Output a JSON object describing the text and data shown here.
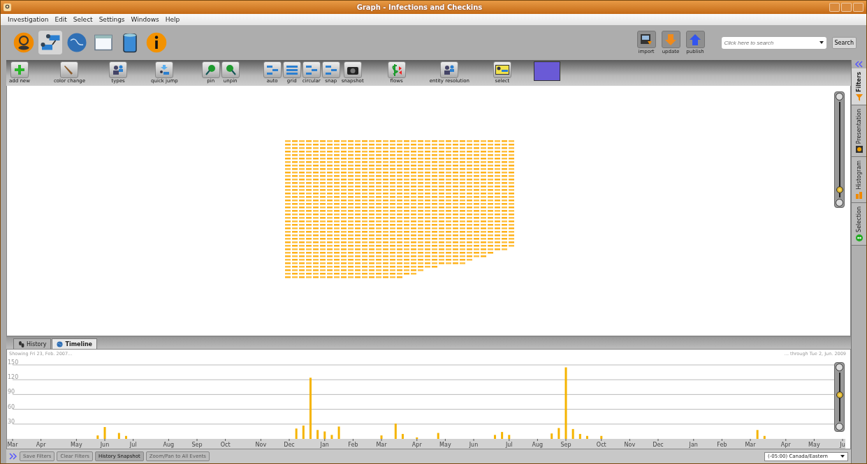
{
  "window": {
    "title": "Graph - Infections and Checkins"
  },
  "menu": [
    "Investigation",
    "Edit",
    "Select",
    "Settings",
    "Windows",
    "Help"
  ],
  "app_toolbar": [
    {
      "kind": "logo",
      "selected": false
    },
    {
      "kind": "graph",
      "selected": true
    },
    {
      "kind": "globe",
      "selected": false
    },
    {
      "kind": "window",
      "selected": false
    },
    {
      "kind": "bin",
      "selected": false
    },
    {
      "kind": "info",
      "selected": false
    }
  ],
  "actions": [
    {
      "label": "import",
      "kind": "import"
    },
    {
      "label": "update",
      "kind": "update"
    },
    {
      "label": "publish",
      "kind": "publish"
    }
  ],
  "search": {
    "placeholder": "Click here to search",
    "button": "Search"
  },
  "graph_toolbar": [
    [
      {
        "label": "add new",
        "kind": "add"
      }
    ],
    [
      {
        "label": "color change",
        "kind": "brush"
      }
    ],
    [
      {
        "label": "types",
        "kind": "people"
      }
    ],
    [
      {
        "label": "quick jump",
        "kind": "jump"
      }
    ],
    [
      {
        "label": "pin",
        "kind": "pin"
      },
      {
        "label": "unpin",
        "kind": "unpin"
      }
    ],
    [
      {
        "label": "auto",
        "kind": "layout"
      },
      {
        "label": "grid",
        "kind": "grid"
      },
      {
        "label": "circular",
        "kind": "layout"
      },
      {
        "label": "snap",
        "kind": "layout"
      },
      {
        "label": "snapshot",
        "kind": "camera"
      }
    ],
    [
      {
        "label": "flows",
        "kind": "money"
      }
    ],
    [
      {
        "label": "entity resolution",
        "kind": "people"
      }
    ],
    [
      {
        "label": "select",
        "kind": "select"
      }
    ]
  ],
  "side_tabs": [
    {
      "label": "Filters",
      "selected": true,
      "kind": "funnel"
    },
    {
      "label": "Presentation",
      "selected": false,
      "kind": "palette"
    },
    {
      "label": "Histogram",
      "selected": false,
      "kind": "bars"
    },
    {
      "label": "Selection",
      "selected": false,
      "kind": "dots"
    }
  ],
  "graph_zoom": {
    "level": 0.08
  },
  "bottom_tabs": [
    {
      "label": "History",
      "selected": false,
      "kind": "history"
    },
    {
      "label": "Timeline",
      "selected": true,
      "kind": "globe"
    }
  ],
  "timeline": {
    "range_start": "Showing Fri 23, Feb. 2007...",
    "range_end": "... through Tue 2, Jun. 2009",
    "zoom": {
      "level": 0.55
    },
    "chart_data": {
      "type": "bar",
      "grid": true,
      "ylim": [
        0,
        150
      ],
      "yticks": [
        30,
        60,
        90,
        120,
        150
      ],
      "categories": [
        "Mar",
        null,
        null,
        null,
        "Apr",
        null,
        null,
        null,
        null,
        "May",
        null,
        null,
        null,
        "Jun",
        null,
        null,
        null,
        "Jul",
        null,
        null,
        null,
        null,
        "Aug",
        null,
        null,
        null,
        "Sep",
        null,
        null,
        null,
        "Oct",
        null,
        null,
        null,
        null,
        "Nov",
        null,
        null,
        null,
        "Dec",
        null,
        null,
        null,
        null,
        "Jan",
        null,
        null,
        null,
        "Feb",
        null,
        null,
        null,
        "Mar",
        null,
        null,
        null,
        null,
        "Apr",
        null,
        null,
        null,
        "May",
        null,
        null,
        null,
        "Jun",
        null,
        null,
        null,
        null,
        "Jul",
        null,
        null,
        null,
        "Aug",
        null,
        null,
        null,
        "Sep",
        null,
        null,
        null,
        null,
        "Oct",
        null,
        null,
        null,
        "Nov",
        null,
        null,
        null,
        "Dec",
        null,
        null,
        null,
        null,
        "Jan",
        null,
        null,
        null,
        "Feb",
        null,
        null,
        null,
        "Mar",
        null,
        null,
        null,
        null,
        "Apr",
        null,
        null,
        null,
        "May",
        null,
        null,
        null,
        "Ju"
      ],
      "series": [
        {
          "color": "#f5b400",
          "values": [
            null,
            null,
            null,
            null,
            null,
            null,
            null,
            null,
            null,
            null,
            null,
            null,
            7,
            24,
            null,
            12,
            6,
            null,
            null,
            null,
            null,
            null,
            null,
            null,
            null,
            null,
            null,
            null,
            null,
            null,
            null,
            null,
            null,
            null,
            null,
            null,
            null,
            null,
            null,
            null,
            21,
            27,
            124,
            18,
            15,
            8,
            25,
            null,
            null,
            null,
            null,
            null,
            7,
            null,
            31,
            10,
            null,
            3,
            null,
            null,
            12,
            null,
            null,
            null,
            null,
            null,
            null,
            null,
            8,
            14,
            8,
            null,
            null,
            null,
            null,
            null,
            11,
            22,
            145,
            20,
            10,
            6,
            null,
            6,
            null,
            null,
            null,
            null,
            null,
            null,
            null,
            null,
            null,
            null,
            null,
            null,
            null,
            null,
            null,
            null,
            null,
            null,
            null,
            null,
            null,
            18,
            6,
            null,
            null,
            null,
            null,
            null,
            null,
            null,
            null,
            null,
            null,
            null
          ]
        }
      ]
    }
  },
  "footer": {
    "buttons": [
      {
        "label": "Save Filters",
        "disabled": true
      },
      {
        "label": "Clear Filters",
        "disabled": true
      },
      {
        "label": "History Snapshot",
        "disabled": false
      },
      {
        "label": "Zoom/Pan to All Events",
        "disabled": true
      }
    ],
    "timezone": "(-05:00) Canada/Eastern"
  }
}
